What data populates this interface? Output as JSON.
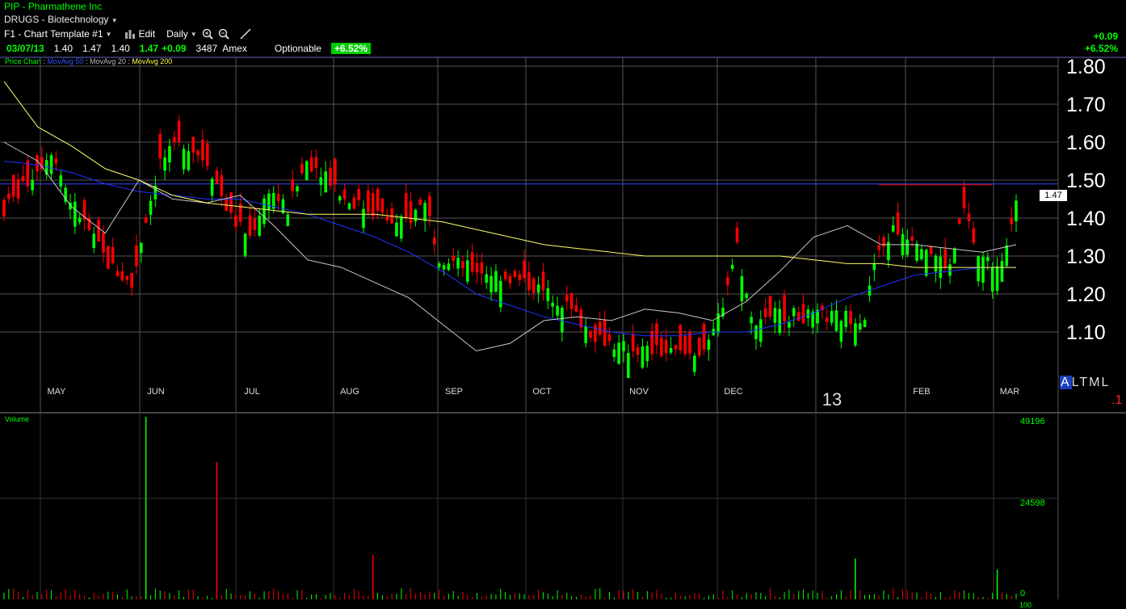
{
  "header": {
    "title": "PIP - Pharmathene Inc",
    "sector": "DRUGS - Biotechnology",
    "template": "F1 - Chart Template #1",
    "edit": "Edit",
    "period": "Daily",
    "date": "03/07/13",
    "open": "1.40",
    "high": "1.47",
    "low": "1.40",
    "last": "1.47",
    "change": "+0.09",
    "volume": "3487",
    "exchange": "Amex",
    "optionable": "Optionable",
    "pct_change": "+6.52%",
    "right_change": "+0.09",
    "right_pct": "+6.52%"
  },
  "legend": {
    "price_chart": "Price Chart",
    "sep": ":",
    "ma50": "MovAvg 50",
    "ma20": "MovAvg 20",
    "ma200": "MovAvg 200",
    "volume": "Volume"
  },
  "right_panel": {
    "price_tag": "1.47",
    "altml": [
      "A",
      "L",
      "T",
      "M",
      "L"
    ],
    "small_label": ".1",
    "bottom_label": "100"
  },
  "colors": {
    "up": "#00ff00",
    "down": "#ff0000",
    "ma50": "#2233ff",
    "ma20": "#c8c8c8",
    "ma200": "#ffff66",
    "grid": "#555555",
    "resistance": "#ff0000"
  },
  "chart_data": [
    {
      "type": "candlestick",
      "title": "Price Chart",
      "ylim": [
        1.0,
        1.85
      ],
      "yticks": [
        "1.80",
        "1.70",
        "1.60",
        "1.50",
        "1.40",
        "1.30",
        "1.20",
        "1.10"
      ],
      "ytick_values": [
        1.8,
        1.7,
        1.6,
        1.5,
        1.4,
        1.3,
        1.2,
        1.1
      ],
      "x_labels": [
        "MAY",
        "JUN",
        "JUL",
        "AUG",
        "SEP",
        "OCT",
        "NOV",
        "DEC",
        "13",
        "FEB",
        "MAR"
      ],
      "reference_lines": [
        1.49
      ],
      "resistance_line": {
        "value": 1.49,
        "from_index": 185,
        "to_index": 209
      },
      "last_price": 1.47,
      "series": [
        {
          "name": "MovAvg 50",
          "from_index": 0,
          "values": [
            1.55,
            1.54,
            1.52,
            1.49,
            1.47,
            1.46,
            1.45,
            1.45,
            1.43,
            1.41,
            1.38,
            1.35,
            1.31,
            1.26,
            1.2,
            1.17,
            1.14,
            1.12,
            1.1,
            1.09,
            1.09,
            1.1,
            1.1,
            1.12,
            1.15,
            1.19,
            1.22,
            1.25,
            1.26,
            1.27,
            1.27
          ]
        },
        {
          "name": "MovAvg 20",
          "from_index": 0,
          "values": [
            1.6,
            1.55,
            1.43,
            1.36,
            1.5,
            1.45,
            1.44,
            1.46,
            1.38,
            1.29,
            1.27,
            1.23,
            1.19,
            1.12,
            1.05,
            1.07,
            1.13,
            1.14,
            1.13,
            1.16,
            1.15,
            1.13,
            1.18,
            1.26,
            1.35,
            1.38,
            1.33,
            1.33,
            1.32,
            1.31,
            1.33
          ]
        },
        {
          "name": "MovAvg 200",
          "from_index": 0,
          "values": [
            1.76,
            1.64,
            1.59,
            1.53,
            1.5,
            1.46,
            1.44,
            1.43,
            1.42,
            1.41,
            1.41,
            1.41,
            1.4,
            1.39,
            1.37,
            1.35,
            1.33,
            1.32,
            1.31,
            1.3,
            1.3,
            1.3,
            1.3,
            1.3,
            1.29,
            1.28,
            1.28,
            1.27,
            1.27,
            1.27,
            1.27
          ]
        }
      ]
    },
    {
      "type": "bar",
      "title": "Volume",
      "ylim": [
        0,
        49196
      ],
      "yticks": [
        "49196",
        "24598",
        "0"
      ],
      "spikes": [
        {
          "index": 30,
          "value": 49196,
          "up": true
        },
        {
          "index": 45,
          "value": 37000,
          "up": false
        },
        {
          "index": 78,
          "value": 12000,
          "up": false
        },
        {
          "index": 180,
          "value": 11000,
          "up": true
        },
        {
          "index": 210,
          "value": 8000,
          "up": true
        }
      ]
    }
  ]
}
